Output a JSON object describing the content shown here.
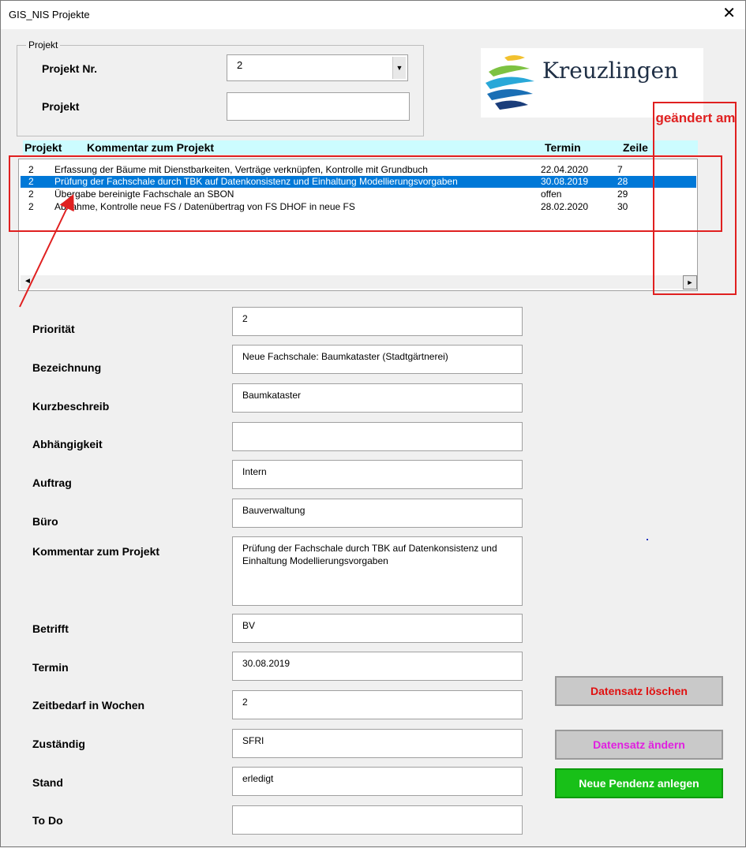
{
  "window": {
    "title": "GIS_NIS Projekte",
    "close_glyph": "✕"
  },
  "group": {
    "legend": "Projekt"
  },
  "fields_top": {
    "projekt_nr_label": "Projekt Nr.",
    "projekt_nr_value": "2",
    "projekt_label": "Projekt",
    "projekt_value": ""
  },
  "logo": {
    "text": "Kreuzlingen"
  },
  "list": {
    "headers": {
      "projekt": "Projekt",
      "kommentar": "Kommentar zum Projekt",
      "termin": "Termin",
      "zeile": "Zeile"
    },
    "rows": [
      {
        "projekt": "2",
        "kommentar": "Erfassung der Bäume mit Dienstbarkeiten, Verträge verknüpfen, Kontrolle mit Grundbuch",
        "termin": "22.04.2020",
        "zeile": "7"
      },
      {
        "projekt": "2",
        "kommentar": "Prüfung der Fachschale durch TBK auf Datenkonsistenz und Einhaltung Modellierungsvorgaben",
        "termin": "30.08.2019",
        "zeile": "28"
      },
      {
        "projekt": "2",
        "kommentar": "Übergabe bereinigte Fachschale an SBON",
        "termin": "offen",
        "zeile": "29"
      },
      {
        "projekt": "2",
        "kommentar": "Abnahme, Kontrolle neue FS / Datenübertrag von FS DHOF in neue FS",
        "termin": "28.02.2020",
        "zeile": "30"
      }
    ],
    "selected_row": 1,
    "scroll_left": "◄",
    "scroll_right": "►"
  },
  "annotation": {
    "text": "geändert am",
    "color": "#e02020"
  },
  "form": {
    "prioritaet": {
      "label": "Priorität",
      "value": "2"
    },
    "bezeichnung": {
      "label": "Bezeichnung",
      "value": "Neue Fachschale: Baumkataster (Stadtgärtnerei)"
    },
    "kurzbeschreib": {
      "label": "Kurzbeschreib",
      "value": "Baumkataster"
    },
    "abhaengigkeit": {
      "label": "Abhängigkeit",
      "value": ""
    },
    "auftrag": {
      "label": "Auftrag",
      "value": "Intern"
    },
    "buero": {
      "label": "Büro",
      "value": "Bauverwaltung"
    },
    "kommentar": {
      "label": "Kommentar zum Projekt",
      "value": "Prüfung der Fachschale durch TBK auf Datenkonsistenz und Einhaltung Modellierungsvorgaben"
    },
    "betrifft": {
      "label": "Betrifft",
      "value": "BV"
    },
    "termin": {
      "label": "Termin",
      "value": "30.08.2019"
    },
    "zeitbedarf": {
      "label": "Zeitbedarf in Wochen",
      "value": "2"
    },
    "zustaendig": {
      "label": "Zuständig",
      "value": "SFRI"
    },
    "stand": {
      "label": "Stand",
      "value": "erledigt"
    },
    "todo": {
      "label": "To Do",
      "value": ""
    }
  },
  "buttons": {
    "loeschen": {
      "label": "Datensatz löschen",
      "color": "#e01010"
    },
    "aendern": {
      "label": "Datensatz ändern",
      "color": "#e020e0"
    },
    "neu": {
      "label": "Neue Pendenz anlegen",
      "color": "#ffffff",
      "background": "#18c018"
    }
  }
}
